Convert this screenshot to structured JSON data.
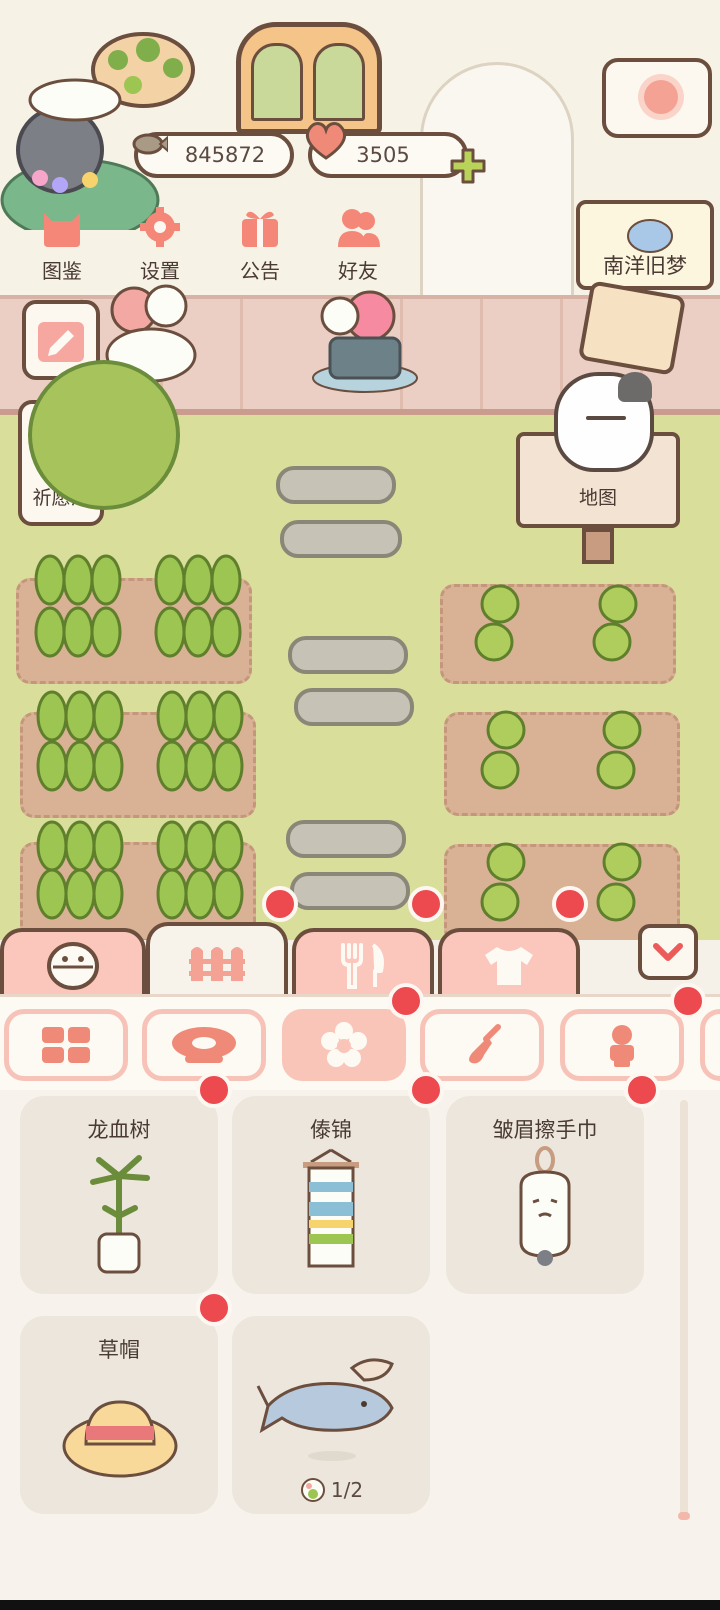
{
  "hud": {
    "fish_count": "845872",
    "heart_count": "3505"
  },
  "menu": {
    "items": [
      {
        "label": "图鉴",
        "icon": "cat-book-icon"
      },
      {
        "label": "设置",
        "icon": "gear-icon"
      },
      {
        "label": "公告",
        "icon": "gift-icon"
      },
      {
        "label": "好友",
        "icon": "friends-icon"
      }
    ]
  },
  "side": {
    "wish_pool_label": "祈愿池",
    "map_label": "地图",
    "event_sign_label": "南洋旧梦"
  },
  "tabs": [
    {
      "icon": "bowl-icon",
      "active": false,
      "dot": false
    },
    {
      "icon": "fence-icon",
      "active": true,
      "dot": true
    },
    {
      "icon": "fork-knife-icon",
      "active": false,
      "dot": true
    },
    {
      "icon": "shirt-icon",
      "active": false,
      "dot": true
    }
  ],
  "subtabs": [
    {
      "icon": "grid-icon",
      "active": false,
      "dot": false
    },
    {
      "icon": "rug-icon",
      "active": false,
      "dot": false
    },
    {
      "icon": "flower-icon",
      "active": true,
      "dot": true
    },
    {
      "icon": "shovel-icon",
      "active": false,
      "dot": false
    },
    {
      "icon": "figure-icon",
      "active": false,
      "dot": true
    }
  ],
  "items": [
    {
      "name": "龙血树",
      "icon": "dragon-tree-icon",
      "dot": true
    },
    {
      "name": "傣锦",
      "icon": "tapestry-icon",
      "dot": true
    },
    {
      "name": "皱眉擦手巾",
      "icon": "cat-towel-icon",
      "dot": true
    },
    {
      "name": "草帽",
      "icon": "straw-hat-icon",
      "dot": true
    },
    {
      "name": "",
      "icon": "shark-pirate-icon",
      "dot": false,
      "count": "1/2"
    }
  ],
  "colors": {
    "accent": "#fac5b9",
    "badge": "#ec4a4f",
    "outline": "#6b4e3e",
    "grass": "#d9df9a"
  }
}
